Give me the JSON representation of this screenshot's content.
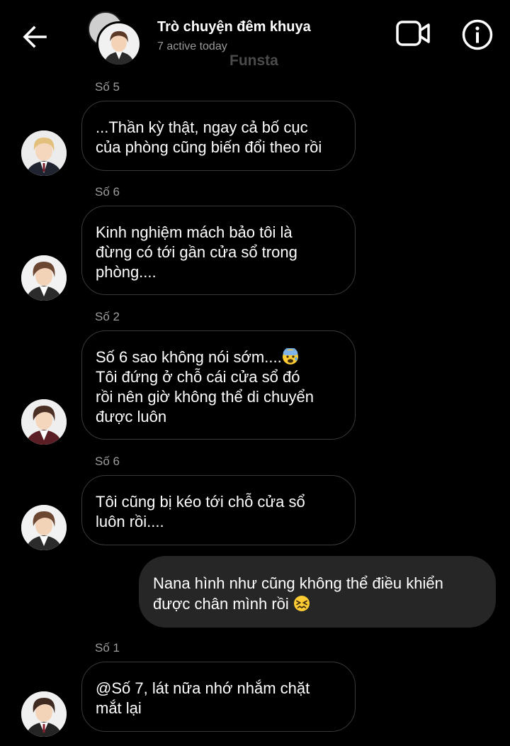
{
  "header": {
    "title": "Trò chuyện đêm khuya",
    "subtitle": "7 active today",
    "watermark": "Funsta",
    "back_icon": "arrow-left-icon",
    "video_icon": "video-camera-icon",
    "info_icon": "info-circle-icon"
  },
  "messages": [
    {
      "sender": "Số 5",
      "text": "...Thần kỳ thật, ngay cả bố cục\ncủa phòng cũng biến đổi theo rồi"
    },
    {
      "sender": "Số 6",
      "text": "Kinh nghiệm mách bảo tôi là\nđừng có tới gần cửa sổ trong\nphòng...."
    },
    {
      "sender": "Số 2",
      "text_line1": "Số 6 sao không nói sớm....",
      "text_rest": "Tôi đứng ở chỗ cái cửa sổ đó\nrồi nên giờ không thể di chuyển\nđược luôn",
      "emoji": "anxious-face-emoji"
    },
    {
      "sender": "Số 6",
      "text": "Tôi cũng bị kéo tới chỗ cửa sổ\nluôn rồi...."
    },
    {
      "sender": "Số 1",
      "text": "@Số 7, lát nữa nhớ nhắm chặt\nmắt lại"
    }
  ],
  "own_message": {
    "text": "Nana hình như cũng không thể điều khiển\nđược chân mình rồi",
    "emoji": "confounded-face-emoji"
  },
  "colors": {
    "background": "#000000",
    "bubble_border": "#3a3a3a",
    "own_bubble": "#262626",
    "secondary_text": "#9e9e9e"
  }
}
